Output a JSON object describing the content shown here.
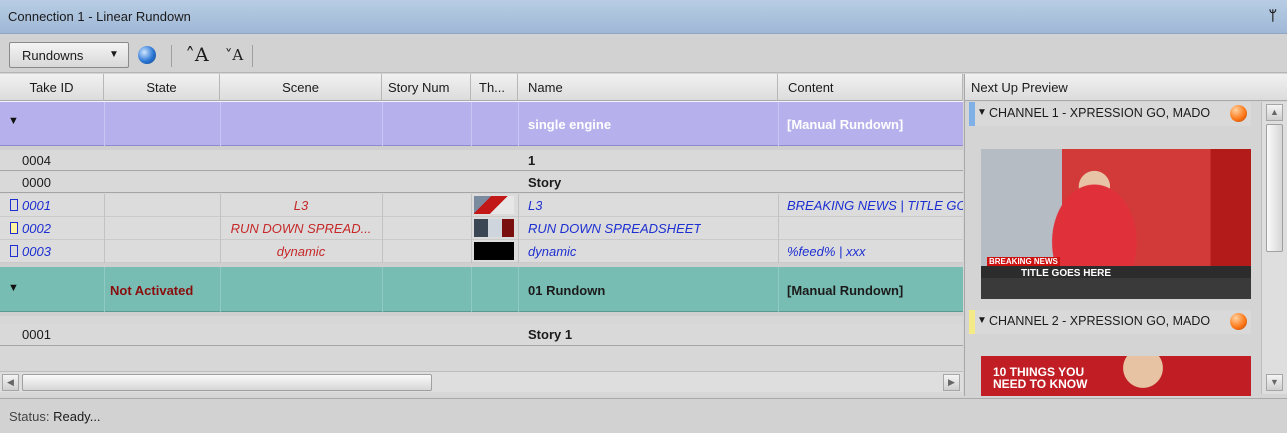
{
  "window": {
    "title": "Connection 1 - Linear Rundown",
    "pin_icon": "pin-icon"
  },
  "toolbar": {
    "rundowns_label": "Rundowns",
    "dropdown_glyph": "▼",
    "refresh_icon": "globe-icon",
    "font_increase_glyph": "˄A",
    "font_decrease_glyph": "˅A"
  },
  "grid": {
    "columns": [
      "Take ID",
      "State",
      "Scene",
      "Story Num",
      "Th...",
      "Name",
      "Content"
    ],
    "rows": [
      {
        "kind": "group",
        "name": "single engine",
        "content": "[Manual Rundown]"
      },
      {
        "kind": "story",
        "take_id": "0004",
        "name": "1"
      },
      {
        "kind": "story",
        "take_id": "0000",
        "name": "Story"
      },
      {
        "kind": "item",
        "take_id": "0001",
        "scene": "L3",
        "name": "L3",
        "content": "BREAKING NEWS | TITLE GO"
      },
      {
        "kind": "item",
        "take_id": "0002",
        "scene": "RUN DOWN SPREAD...",
        "name": "RUN DOWN SPREADSHEET",
        "content": ""
      },
      {
        "kind": "item",
        "take_id": "0003",
        "scene": "dynamic",
        "name": "dynamic",
        "content": "%feed% | xxx"
      },
      {
        "kind": "group",
        "state": "Not Activated",
        "name": "01 Rundown",
        "content": "[Manual Rundown]"
      },
      {
        "kind": "story",
        "take_id": "0001",
        "name": "Story 1"
      }
    ]
  },
  "preview": {
    "header": "Next Up Preview",
    "channels": [
      {
        "label": "CHANNEL 1 - XPRESSION GO, MADO",
        "strip_color": "#7fb0e6",
        "lower_third_label": "BREAKING NEWS",
        "lower_third_title": "TITLE GOES HERE"
      },
      {
        "label": "CHANNEL 2 - XPRESSION GO, MADO",
        "strip_color": "#f4ea86",
        "promo_line1": "10 THINGS YOU",
        "promo_line2": "NEED TO KNOW"
      }
    ]
  },
  "status": {
    "label": "Status:",
    "value": "Ready..."
  }
}
